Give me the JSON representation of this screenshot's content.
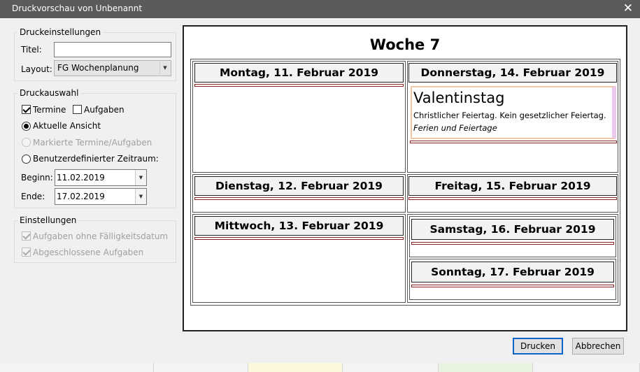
{
  "window": {
    "title": "Druckvorschau von Unbenannt",
    "close_glyph": "✕"
  },
  "settings": {
    "legend": "Druckeinstellungen",
    "title_label": "Titel:",
    "title_value": "",
    "layout_label": "Layout:",
    "layout_value": "FG Wochenplanung"
  },
  "selection": {
    "legend": "Druckauswahl",
    "termine_label": "Termine",
    "termine_checked": true,
    "aufgaben_label": "Aufgaben",
    "aufgaben_checked": false,
    "radio_current": "Aktuelle Ansicht",
    "radio_marked": "Markierte Termine/Aufgaben",
    "radio_custom": "Benutzerdefinierter Zeitraum:",
    "selected_radio": "current",
    "begin_label": "Beginn:",
    "begin_value": "11.02.2019",
    "end_label": "Ende:",
    "end_value": "17.02.2019"
  },
  "options": {
    "legend": "Einstellungen",
    "no_due_label": "Aufgaben ohne Fälligkeitsdatum",
    "completed_label": "Abgeschlossene Aufgaben"
  },
  "preview": {
    "week_title": "Woche 7",
    "days": {
      "mon": "Montag, 11. Februar 2019",
      "tue": "Dienstag, 12. Februar 2019",
      "wed": "Mittwoch, 13. Februar 2019",
      "thu": "Donnerstag, 14. Februar 2019",
      "fri": "Freitag, 15. Februar 2019",
      "sat": "Samstag, 16. Februar 2019",
      "sun": "Sonntag, 17. Februar 2019"
    },
    "event": {
      "title": "Valentinstag",
      "description": "Christlicher Feiertag. Kein gesetzlicher Feiertag.",
      "category": "Ferien und Feiertage",
      "border_color": "#f1c6a5",
      "side_color": "#ecc9ec"
    }
  },
  "buttons": {
    "print": "Drucken",
    "cancel": "Abbrechen"
  },
  "colors": {
    "titlebar": "#5b5b5b",
    "accent": "#0a64c8",
    "day_bar": "#8b1e1e"
  }
}
